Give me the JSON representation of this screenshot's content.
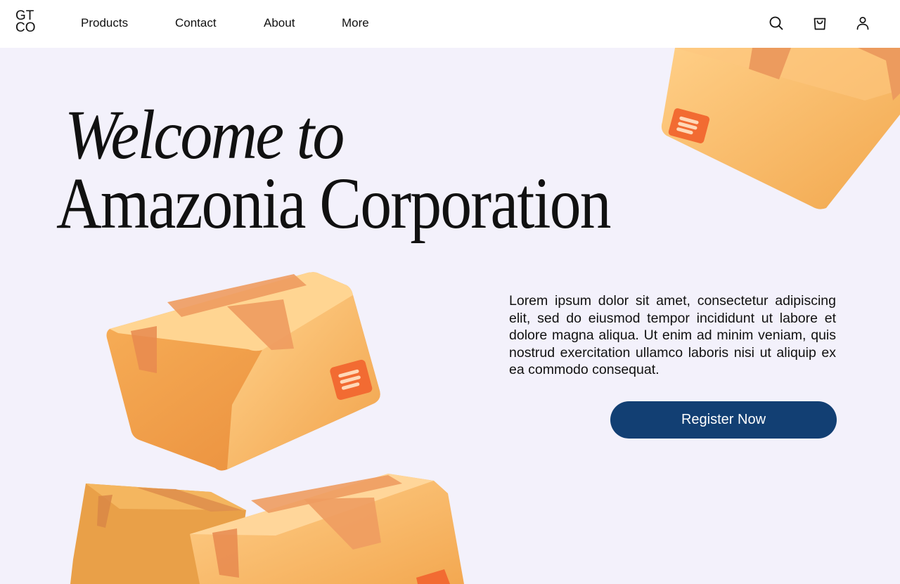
{
  "header": {
    "logo": [
      "GT",
      "CO"
    ],
    "nav": [
      {
        "label": "Products"
      },
      {
        "label": "Contact"
      },
      {
        "label": "About"
      },
      {
        "label": "More"
      }
    ],
    "icons": [
      "search-icon",
      "shopping-bag-icon",
      "user-icon"
    ]
  },
  "hero": {
    "title_line1": "Welcome to",
    "title_line2": "Amazonia Corporation",
    "body": "Lorem ipsum dolor sit amet, consectetur adipiscing elit, sed do eiusmod tempor incididunt ut labore et dolore magna aliqua. Ut enim ad minim veniam, quis nostrud exercitation ullamco laboris nisi ut aliquip ex ea commodo consequat.",
    "cta_label": "Register Now"
  },
  "colors": {
    "background": "#f3f1fb",
    "header": "#ffffff",
    "cta": "#123f73",
    "box": "#f9b760",
    "tape": "#ef9a62",
    "label": "#f26b32"
  }
}
